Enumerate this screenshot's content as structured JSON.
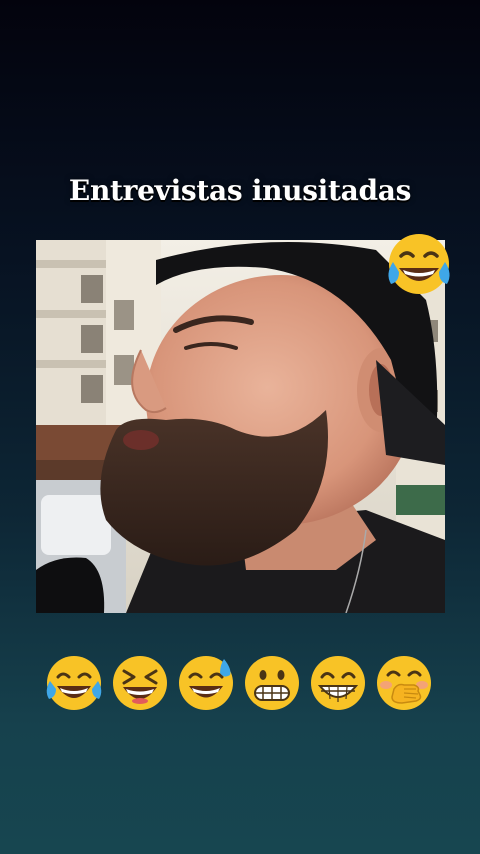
{
  "post": {
    "title": "Entrevistas inusitadas"
  },
  "video": {
    "description_icon": "video-frame"
  },
  "reactions": [
    {
      "icon": "tears-of-joy-emoji"
    },
    {
      "icon": "squinting-laugh-emoji"
    },
    {
      "icon": "sweat-smile-emoji"
    },
    {
      "icon": "grimacing-emoji"
    },
    {
      "icon": "beaming-grin-emoji"
    },
    {
      "icon": "hand-over-mouth-emoji"
    }
  ],
  "corner_reaction": {
    "icon": "tears-of-joy-emoji"
  },
  "colors": {
    "background_top": "#03030d",
    "background_bottom": "#174650",
    "emoji_yellow": "#f8c326"
  }
}
